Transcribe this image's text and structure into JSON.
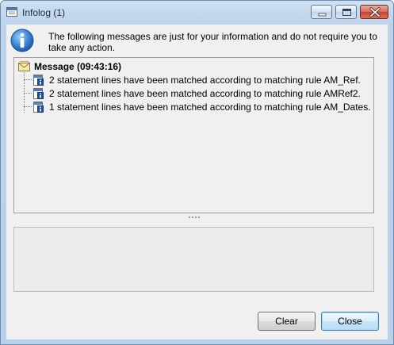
{
  "window": {
    "title": "Infolog (1)",
    "icon": "infolog-window-icon",
    "controls": [
      "minimize-icon",
      "maximize-icon",
      "close-icon"
    ]
  },
  "intro": {
    "icon": "info-icon",
    "text": "The following messages are just for your information and do not require you to take any action."
  },
  "tree": {
    "header": {
      "icon": "message-envelope-icon",
      "label": "Message (09:43:16)"
    },
    "items": [
      {
        "icon": "info-message-icon",
        "text": "2 statement lines have been matched according to matching rule AM_Ref."
      },
      {
        "icon": "info-message-icon",
        "text": "2 statement lines have been matched according to matching rule AMRef2."
      },
      {
        "icon": "info-message-icon",
        "text": "1 statement lines have been matched according to matching rule AM_Dates."
      }
    ]
  },
  "buttons": {
    "clear_label": "Clear",
    "close_label": "Close"
  },
  "colors": {
    "frame": "#b9d0e8",
    "close_button": "#c3422c",
    "info_icon": "#2f6fc4",
    "default_button_border": "#3c7fb1"
  }
}
